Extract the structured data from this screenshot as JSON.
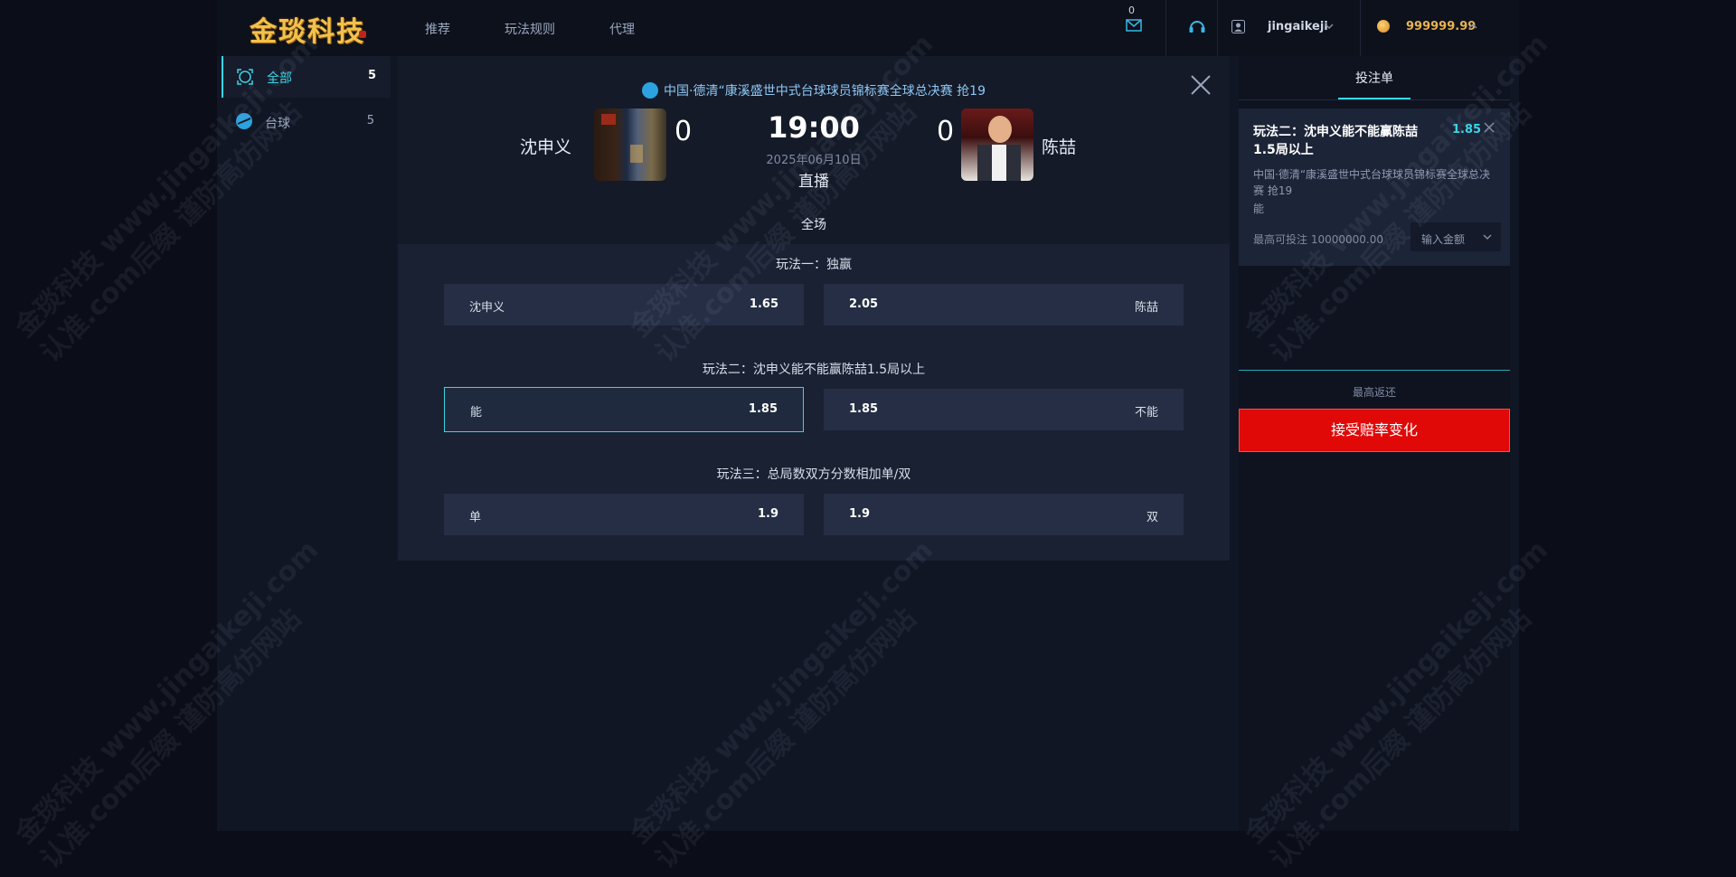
{
  "brand": {
    "logo_text": "金琰科技"
  },
  "nav": [
    {
      "label": "推荐"
    },
    {
      "label": "玩法规则"
    },
    {
      "label": "代理"
    }
  ],
  "header": {
    "mail_count": "0",
    "username": "jingaikeji",
    "balance": "999999.99"
  },
  "sidebar": {
    "items": [
      {
        "label": "全部",
        "count": "5"
      },
      {
        "label": "台球",
        "count": "5"
      }
    ]
  },
  "match": {
    "league": "中国·德清“康溪盛世中式台球球员锦标赛全球总决赛 抢19",
    "home_name": "沈申义",
    "away_name": "陈喆",
    "home_score": "0",
    "away_score": "0",
    "time": "19:00",
    "date": "2025年06月10日",
    "status": "直播",
    "period_tab": "全场"
  },
  "plays": [
    {
      "title": "玩法一：独赢",
      "left": {
        "name": "沈申义",
        "odds": "1.65"
      },
      "right": {
        "name": "陈喆",
        "odds": "2.05"
      }
    },
    {
      "title": "玩法二：沈申义能不能赢陈喆1.5局以上",
      "left": {
        "name": "能",
        "odds": "1.85"
      },
      "right": {
        "name": "不能",
        "odds": "1.85"
      }
    },
    {
      "title": "玩法三：总局数双方分数相加单/双",
      "left": {
        "name": "单",
        "odds": "1.9"
      },
      "right": {
        "name": "双",
        "odds": "1.9"
      }
    }
  ],
  "slip": {
    "title": "投注单",
    "ticket_title": "玩法二：沈申义能不能赢陈喆1.5局以上",
    "ticket_odds": "1.85",
    "ticket_league": "中国·德清“康溪盛世中式台球球员锦标赛全球总决赛 抢19",
    "ticket_pick": "能",
    "max_bet": "最高可投注 10000000.00",
    "amount_placeholder": "输入金额",
    "max_return_label": "最高返还",
    "accept_button": "接受赔率变化"
  },
  "watermark": {
    "line1": "金琰科技 www.jingaikeji.com",
    "line2": "认准.com后缀 谨防高仿网站"
  },
  "colors": {
    "accent": "#38d6e6",
    "danger": "#e10808",
    "gold": "#e9b44c"
  }
}
